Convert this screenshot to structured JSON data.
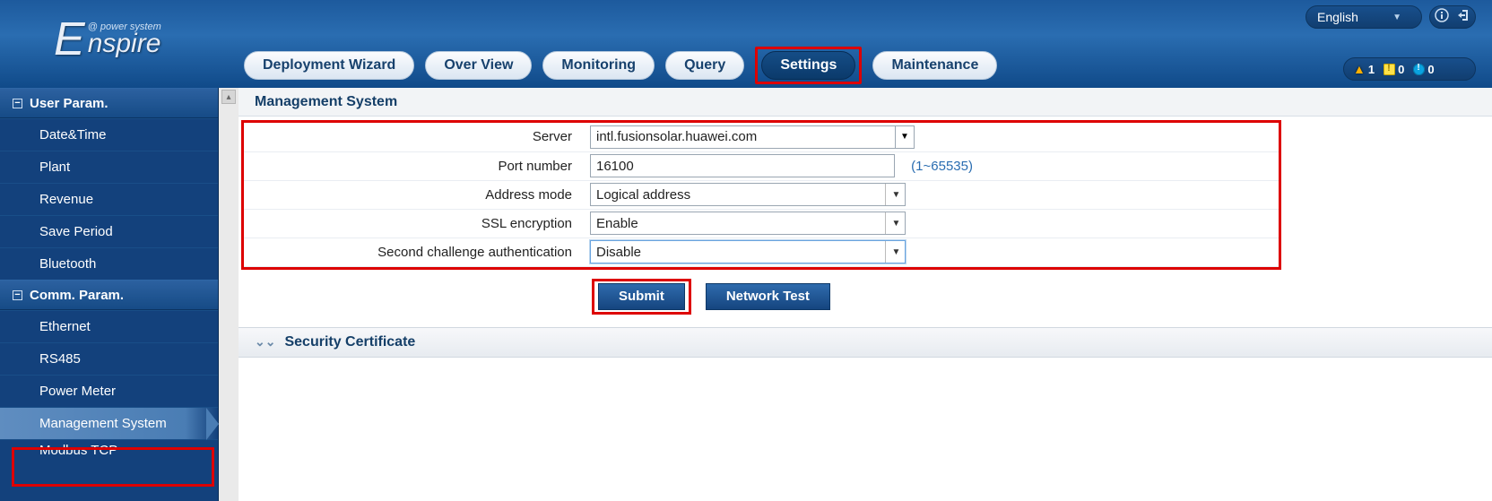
{
  "brand": {
    "letter": "E",
    "line1": "@ power system",
    "line2": "nspire"
  },
  "language": "English",
  "alarms": {
    "warning": "1",
    "minor": "0",
    "info": "0"
  },
  "tabs": [
    {
      "label": "Deployment Wizard"
    },
    {
      "label": "Over View"
    },
    {
      "label": "Monitoring"
    },
    {
      "label": "Query"
    },
    {
      "label": "Settings",
      "active": true,
      "boxed": true
    },
    {
      "label": "Maintenance"
    }
  ],
  "sidebar": {
    "section1": {
      "title": "User Param."
    },
    "items1": [
      {
        "label": "Date&Time"
      },
      {
        "label": "Plant"
      },
      {
        "label": "Revenue"
      },
      {
        "label": "Save Period"
      },
      {
        "label": "Bluetooth"
      }
    ],
    "section2": {
      "title": "Comm. Param."
    },
    "items2": [
      {
        "label": "Ethernet"
      },
      {
        "label": "RS485"
      },
      {
        "label": "Power Meter"
      },
      {
        "label": "Management System",
        "active": true,
        "boxed": true
      },
      {
        "label": "Modbus TCP"
      }
    ]
  },
  "panel": {
    "title": "Management System",
    "rows": {
      "server": {
        "label": "Server",
        "value": "intl.fusionsolar.huawei.com"
      },
      "port": {
        "label": "Port number",
        "value": "16100",
        "hint": "(1~65535)"
      },
      "addr": {
        "label": "Address mode",
        "value": "Logical address"
      },
      "ssl": {
        "label": "SSL encryption",
        "value": "Enable"
      },
      "second": {
        "label": "Second challenge authentication",
        "value": "Disable"
      }
    },
    "buttons": {
      "submit": "Submit",
      "nettest": "Network Test"
    },
    "cert_section": "Security Certificate"
  }
}
